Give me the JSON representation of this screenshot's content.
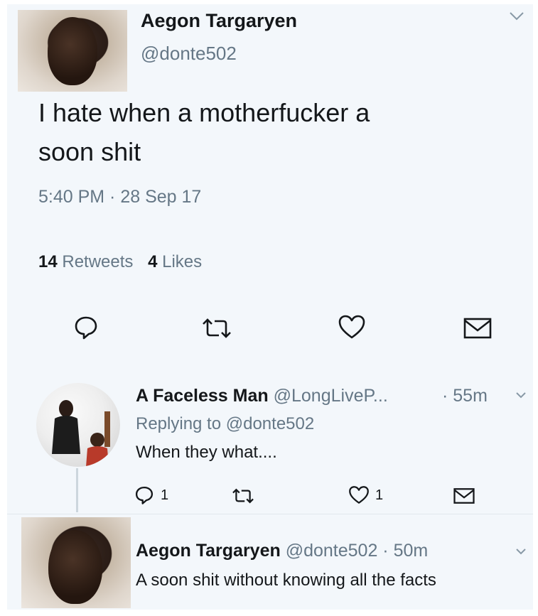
{
  "main_tweet": {
    "author_name": "Aegon Targaryen",
    "handle": "@donte502",
    "text_line1": "I hate when a motherfucker a",
    "text_line2": "soon shit",
    "timestamp": "5:40 PM · 28 Sep 17",
    "retweet_count": "14",
    "retweet_label": "Retweets",
    "like_count": "4",
    "like_label": "Likes"
  },
  "reply1": {
    "author_name": "A Faceless Man",
    "handle": "@LongLiveP...",
    "time": "· 55m",
    "replying_prefix": "Replying to ",
    "replying_handle": "@donte502",
    "text": "When they what....",
    "reply_count": "1",
    "like_count": "1"
  },
  "reply2": {
    "author_name": "Aegon Targaryen",
    "handle_time": "@donte502 · 50m",
    "text": "A soon shit without knowing all the facts"
  },
  "icons": {
    "reply": "reply-icon",
    "retweet": "retweet-icon",
    "like": "heart-icon",
    "message": "envelope-icon",
    "menu": "chevron-down-icon"
  },
  "colors": {
    "text": "#14171a",
    "muted": "#657786",
    "background": "#f3f7fb"
  }
}
